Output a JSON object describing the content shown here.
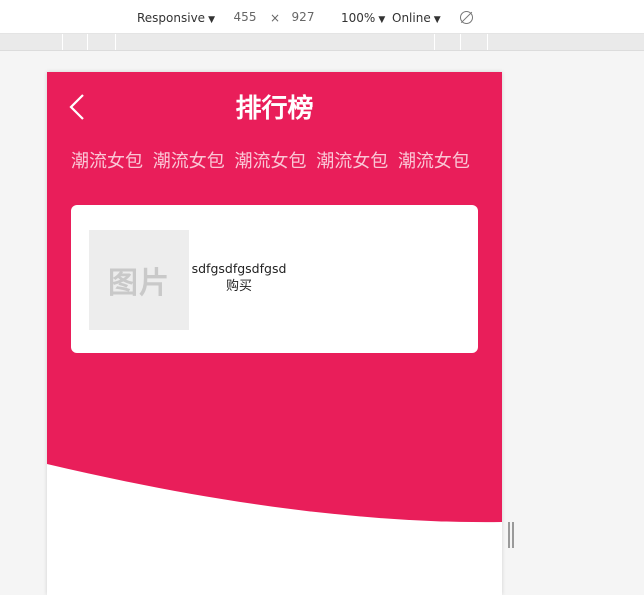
{
  "devtools": {
    "device_mode": "Responsive",
    "width": "455",
    "times": "×",
    "height": "927",
    "zoom": "100%",
    "network": "Online",
    "rotate_icon": "rotate-icon"
  },
  "page": {
    "back_icon": "chevron-left-icon",
    "title": "排行榜",
    "tags": [
      "潮流女包",
      "潮流女包",
      "潮流女包",
      "潮流女包",
      "潮流女包"
    ],
    "product": {
      "image_placeholder": "图片",
      "name": "sdfgsdfgsdfgsd",
      "buy_label": "购买"
    }
  },
  "colors": {
    "accent": "#e91e5a",
    "card": "#ffffff",
    "placeholder_bg": "#ededed"
  }
}
